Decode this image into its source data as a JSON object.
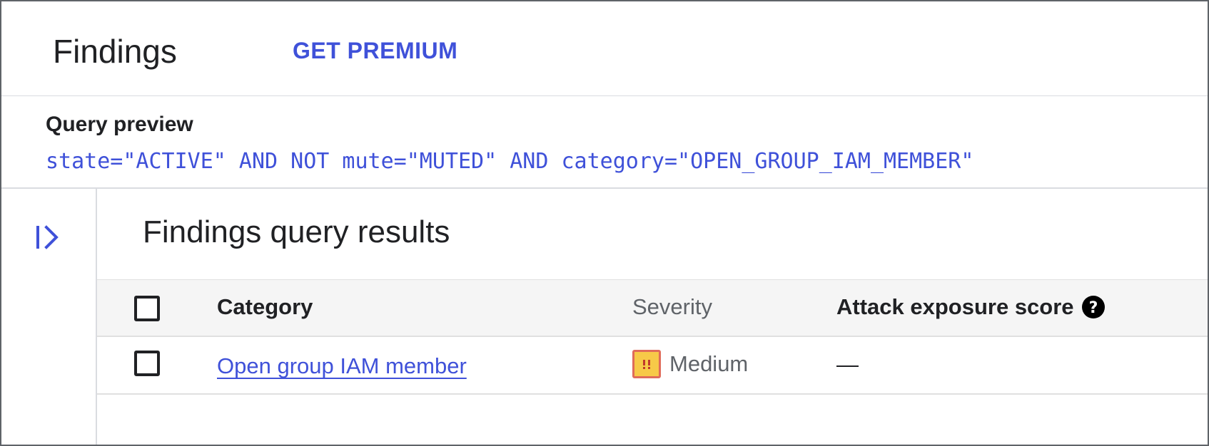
{
  "header": {
    "title": "Findings",
    "premium_label": "GET PREMIUM"
  },
  "query": {
    "label": "Query preview",
    "text": "state=\"ACTIVE\" AND NOT mute=\"MUTED\" AND category=\"OPEN_GROUP_IAM_MEMBER\""
  },
  "rail": {
    "expand_icon": "expand-panel-icon"
  },
  "results": {
    "title": "Findings query results",
    "columns": {
      "category": "Category",
      "severity": "Severity",
      "score": "Attack exposure score",
      "score_help_icon": "help-icon"
    },
    "rows": [
      {
        "category": "Open group IAM member",
        "severity": "Medium",
        "severity_icon": "medium-severity-icon",
        "score": "—"
      }
    ]
  },
  "colors": {
    "accent": "#3f51d9",
    "severity_medium_fill": "#f7c948",
    "severity_medium_border": "#e06b5a",
    "header_bg": "#f5f5f5"
  }
}
